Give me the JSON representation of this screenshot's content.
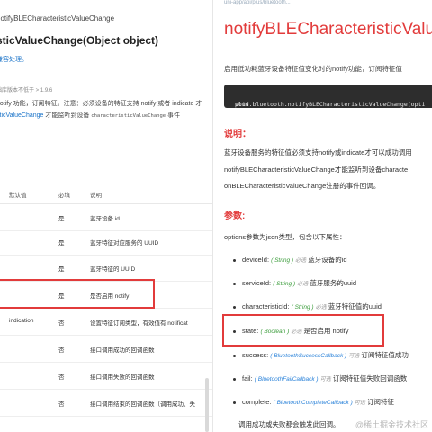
{
  "left": {
    "breadcrumb": "notifyBLECharacteristicValueChange",
    "title": "sticValueChange(Object object)",
    "subtitle": "兼容处理。",
    "meta": "础库版本不低于 > 1.9.6",
    "desc1": "notify 功能，订阅特征。注意：必须设备的特征支持 notify 或者 indicate 才",
    "desc2_link": "sticValueChange",
    "desc2_text": " 才能监听到设备 ",
    "desc2_code": "characteristicValueChange",
    "desc2_tail": " 事件",
    "table_headers": {
      "default": "默认值",
      "required": "必填",
      "desc": "说明"
    },
    "rows": [
      {
        "default": "",
        "required": "是",
        "desc": "蓝牙设备 id"
      },
      {
        "default": "",
        "required": "是",
        "desc": "蓝牙特征对应服务的 UUID"
      },
      {
        "default": "",
        "required": "是",
        "desc": "蓝牙特征的 UUID"
      },
      {
        "default": "",
        "required": "是",
        "desc": "是否启用 notify"
      },
      {
        "default": "indication",
        "required": "否",
        "desc": "设置特征订阅类型，有效值有 notificat"
      },
      {
        "default": "",
        "required": "否",
        "desc": "接口调用成功的回调函数"
      },
      {
        "default": "",
        "required": "否",
        "desc": "接口调用失败的回调函数"
      },
      {
        "default": "",
        "required": "否",
        "desc": "接口调用结束的回调函数（调用成功、失"
      }
    ]
  },
  "right": {
    "url_fragment": "uni-app/api/plus/bluetooth...",
    "title": "notifyBLECharacteristicValue",
    "intro": "启用低功耗蓝牙设备特征值变化时的notify功能，订阅特征值",
    "code_kw": "void",
    "code_text": " plus.bluetooth.notifyBLECharacteristicValueChange(opti",
    "explain_heading": "说明：",
    "explain_lines": [
      "蓝牙设备服务的特征值必须支持notify或indicate才可以成功调用",
      "notifyBLECharacteristicValueChange才能监听到设备characte",
      "onBLECharacteristicValueChange注册的事件回调。"
    ],
    "params_heading": "参数:",
    "options_intro": "options参数为json类型，包含以下属性：",
    "params": [
      {
        "name": "deviceId",
        "type": "String",
        "tag": "必选",
        "desc": "蓝牙设备的id"
      },
      {
        "name": "serviceId",
        "type": "String",
        "tag": "必选",
        "desc": "蓝牙服务的uuid"
      },
      {
        "name": "characteristicId",
        "type": "String",
        "tag": "必选",
        "desc": "蓝牙特征值的uuid"
      },
      {
        "name": "state",
        "type": "Boolean",
        "tag": "必选",
        "desc": "是否启用 notify"
      },
      {
        "name": "success",
        "type": "BluetoothSuccessCallback",
        "tag": "可选",
        "desc": "订阅特征值成功"
      },
      {
        "name": "fail",
        "type": "BluetoothFailCallback",
        "tag": "可选",
        "desc": "订阅特征值失败回调函数"
      },
      {
        "name": "complete",
        "type": "BluetoothCompleteCallback",
        "tag": "可选",
        "desc": "订阅特征"
      }
    ],
    "last_line": "调用成功或失败都会触发此回调。",
    "watermark": "@稀土掘金技术社区"
  }
}
